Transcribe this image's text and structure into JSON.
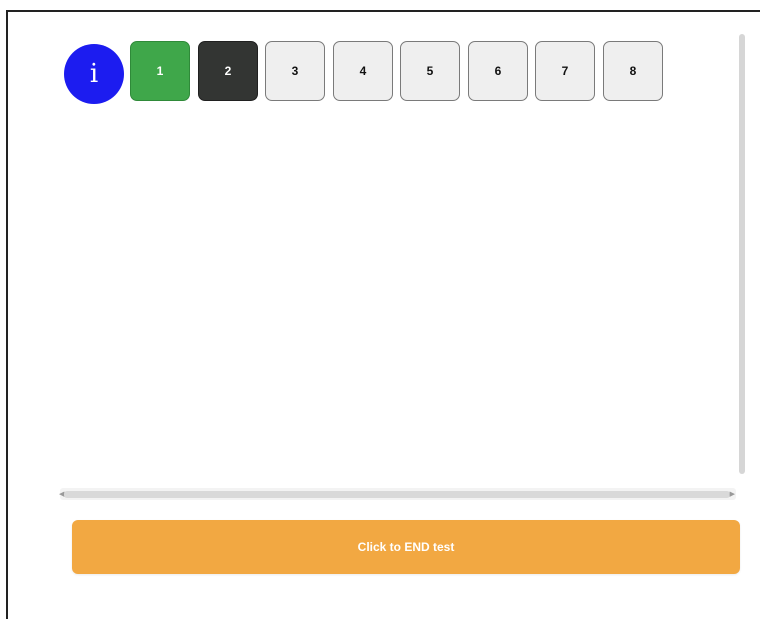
{
  "info_button": {
    "label": "i",
    "color": "#1c1cf0"
  },
  "question_nav": {
    "items": [
      {
        "label": "1",
        "state": "answered",
        "color": "#3fa74a"
      },
      {
        "label": "2",
        "state": "current",
        "color": "#333533"
      },
      {
        "label": "3",
        "state": "unanswered",
        "color": "#efefef"
      },
      {
        "label": "4",
        "state": "unanswered",
        "color": "#efefef"
      },
      {
        "label": "5",
        "state": "unanswered",
        "color": "#efefef"
      },
      {
        "label": "6",
        "state": "unanswered",
        "color": "#efefef"
      },
      {
        "label": "7",
        "state": "unanswered",
        "color": "#efefef"
      },
      {
        "label": "8",
        "state": "unanswered",
        "color": "#efefef"
      }
    ]
  },
  "end_button": {
    "label": "Click to END test",
    "color": "#f2a842"
  }
}
